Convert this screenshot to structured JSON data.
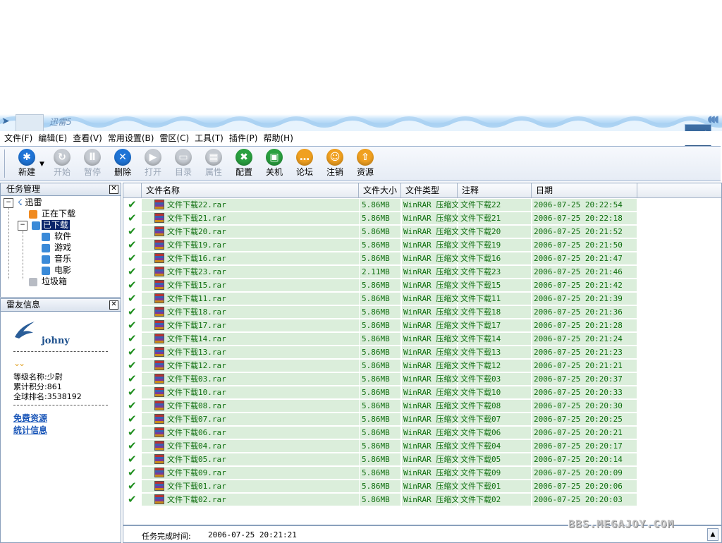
{
  "window": {
    "title": "迅雷5"
  },
  "menu": [
    "文件(F)",
    "编辑(E)",
    "查看(V)",
    "常用设置(B)",
    "雷区(C)",
    "工具(T)",
    "插件(P)",
    "帮助(H)"
  ],
  "toolbar": [
    {
      "label": "新建",
      "icon": "new-icon",
      "color": "#1f74d6",
      "glyph": "✱",
      "enabled": true
    },
    {
      "label": "开始",
      "icon": "start-icon",
      "color": "#c6cbd2",
      "glyph": "↻",
      "enabled": false
    },
    {
      "label": "暂停",
      "icon": "pause-icon",
      "color": "#c6cbd2",
      "glyph": "Ⅱ",
      "enabled": false
    },
    {
      "label": "删除",
      "icon": "delete-icon",
      "color": "#1f74d6",
      "glyph": "✕",
      "enabled": true
    },
    {
      "label": "打开",
      "icon": "open-icon",
      "color": "#c6cbd2",
      "glyph": "▶",
      "enabled": false
    },
    {
      "label": "目录",
      "icon": "folder-icon",
      "color": "#c6cbd2",
      "glyph": "▭",
      "enabled": false
    },
    {
      "label": "属性",
      "icon": "properties-icon",
      "color": "#c6cbd2",
      "glyph": "▦",
      "enabled": false
    },
    {
      "label": "配置",
      "icon": "config-icon",
      "color": "#2aa040",
      "glyph": "✖",
      "enabled": true
    },
    {
      "label": "关机",
      "icon": "shutdown-icon",
      "color": "#2aa040",
      "glyph": "▣",
      "enabled": true
    },
    {
      "label": "论坛",
      "icon": "forum-icon",
      "color": "#f0a020",
      "glyph": "…",
      "enabled": true
    },
    {
      "label": "注销",
      "icon": "logout-icon",
      "color": "#f0a020",
      "glyph": "☺",
      "enabled": true
    },
    {
      "label": "资源",
      "icon": "resource-icon",
      "color": "#f0a020",
      "glyph": "⇧",
      "enabled": true
    }
  ],
  "task_panel": {
    "title": "任务管理",
    "tree": {
      "root": "迅雷",
      "downloading": "正在下载",
      "downloaded": "已下载",
      "categories": [
        "软件",
        "游戏",
        "音乐",
        "电影"
      ],
      "trash": "垃圾箱"
    }
  },
  "buddy_panel": {
    "title": "雷友信息",
    "username": "johny",
    "rank_label": "等级名称:少尉",
    "points_label": "累计积分:861",
    "global_rank_label": "全球排名:3538192",
    "links": [
      "免费资源",
      "统计信息"
    ]
  },
  "list": {
    "columns": [
      "文件名称",
      "文件大小",
      "文件类型",
      "注释",
      "日期"
    ],
    "rows": [
      {
        "name": "文件下载22.rar",
        "size": "5.86MB",
        "type": "WinRAR 压缩文",
        "note": "文件下载22",
        "date": "2006-07-25 20:22:54"
      },
      {
        "name": "文件下载21.rar",
        "size": "5.86MB",
        "type": "WinRAR 压缩文",
        "note": "文件下载21",
        "date": "2006-07-25 20:22:18"
      },
      {
        "name": "文件下载20.rar",
        "size": "5.86MB",
        "type": "WinRAR 压缩文",
        "note": "文件下载20",
        "date": "2006-07-25 20:21:52"
      },
      {
        "name": "文件下载19.rar",
        "size": "5.86MB",
        "type": "WinRAR 压缩文",
        "note": "文件下载19",
        "date": "2006-07-25 20:21:50"
      },
      {
        "name": "文件下载16.rar",
        "size": "5.86MB",
        "type": "WinRAR 压缩文",
        "note": "文件下载16",
        "date": "2006-07-25 20:21:47"
      },
      {
        "name": "文件下载23.rar",
        "size": "2.11MB",
        "type": "WinRAR 压缩文",
        "note": "文件下载23",
        "date": "2006-07-25 20:21:46"
      },
      {
        "name": "文件下载15.rar",
        "size": "5.86MB",
        "type": "WinRAR 压缩文",
        "note": "文件下载15",
        "date": "2006-07-25 20:21:42"
      },
      {
        "name": "文件下载11.rar",
        "size": "5.86MB",
        "type": "WinRAR 压缩文",
        "note": "文件下载11",
        "date": "2006-07-25 20:21:39"
      },
      {
        "name": "文件下载18.rar",
        "size": "5.86MB",
        "type": "WinRAR 压缩文",
        "note": "文件下载18",
        "date": "2006-07-25 20:21:36"
      },
      {
        "name": "文件下载17.rar",
        "size": "5.86MB",
        "type": "WinRAR 压缩文",
        "note": "文件下载17",
        "date": "2006-07-25 20:21:28"
      },
      {
        "name": "文件下载14.rar",
        "size": "5.86MB",
        "type": "WinRAR 压缩文",
        "note": "文件下载14",
        "date": "2006-07-25 20:21:24"
      },
      {
        "name": "文件下载13.rar",
        "size": "5.86MB",
        "type": "WinRAR 压缩文",
        "note": "文件下载13",
        "date": "2006-07-25 20:21:23"
      },
      {
        "name": "文件下载12.rar",
        "size": "5.86MB",
        "type": "WinRAR 压缩文",
        "note": "文件下载12",
        "date": "2006-07-25 20:21:21"
      },
      {
        "name": "文件下载03.rar",
        "size": "5.86MB",
        "type": "WinRAR 压缩文",
        "note": "文件下载03",
        "date": "2006-07-25 20:20:37"
      },
      {
        "name": "文件下载10.rar",
        "size": "5.86MB",
        "type": "WinRAR 压缩文",
        "note": "文件下载10",
        "date": "2006-07-25 20:20:33"
      },
      {
        "name": "文件下载08.rar",
        "size": "5.86MB",
        "type": "WinRAR 压缩文",
        "note": "文件下载08",
        "date": "2006-07-25 20:20:30"
      },
      {
        "name": "文件下载07.rar",
        "size": "5.86MB",
        "type": "WinRAR 压缩文",
        "note": "文件下载07",
        "date": "2006-07-25 20:20:25"
      },
      {
        "name": "文件下载06.rar",
        "size": "5.86MB",
        "type": "WinRAR 压缩文",
        "note": "文件下载06",
        "date": "2006-07-25 20:20:21"
      },
      {
        "name": "文件下载04.rar",
        "size": "5.86MB",
        "type": "WinRAR 压缩文",
        "note": "文件下载04",
        "date": "2006-07-25 20:20:17"
      },
      {
        "name": "文件下载05.rar",
        "size": "5.86MB",
        "type": "WinRAR 压缩文",
        "note": "文件下载05",
        "date": "2006-07-25 20:20:14"
      },
      {
        "name": "文件下载09.rar",
        "size": "5.86MB",
        "type": "WinRAR 压缩文",
        "note": "文件下载09",
        "date": "2006-07-25 20:20:09"
      },
      {
        "name": "文件下载01.rar",
        "size": "5.86MB",
        "type": "WinRAR 压缩文",
        "note": "文件下载01",
        "date": "2006-07-25 20:20:06"
      },
      {
        "name": "文件下载02.rar",
        "size": "5.86MB",
        "type": "WinRAR 压缩文",
        "note": "文件下载02",
        "date": "2006-07-25 20:20:03"
      }
    ]
  },
  "status": {
    "label": "任务完成时间:",
    "value": "2006-07-25 20:21:21"
  },
  "watermark": "BBS.MEGAJOY.COM",
  "colors": {
    "row_text": "#0e6e0e",
    "row_bg": "#dbeedb",
    "check": "#1f8f1f",
    "selected": "#0a246a",
    "link": "#1a56b8"
  }
}
